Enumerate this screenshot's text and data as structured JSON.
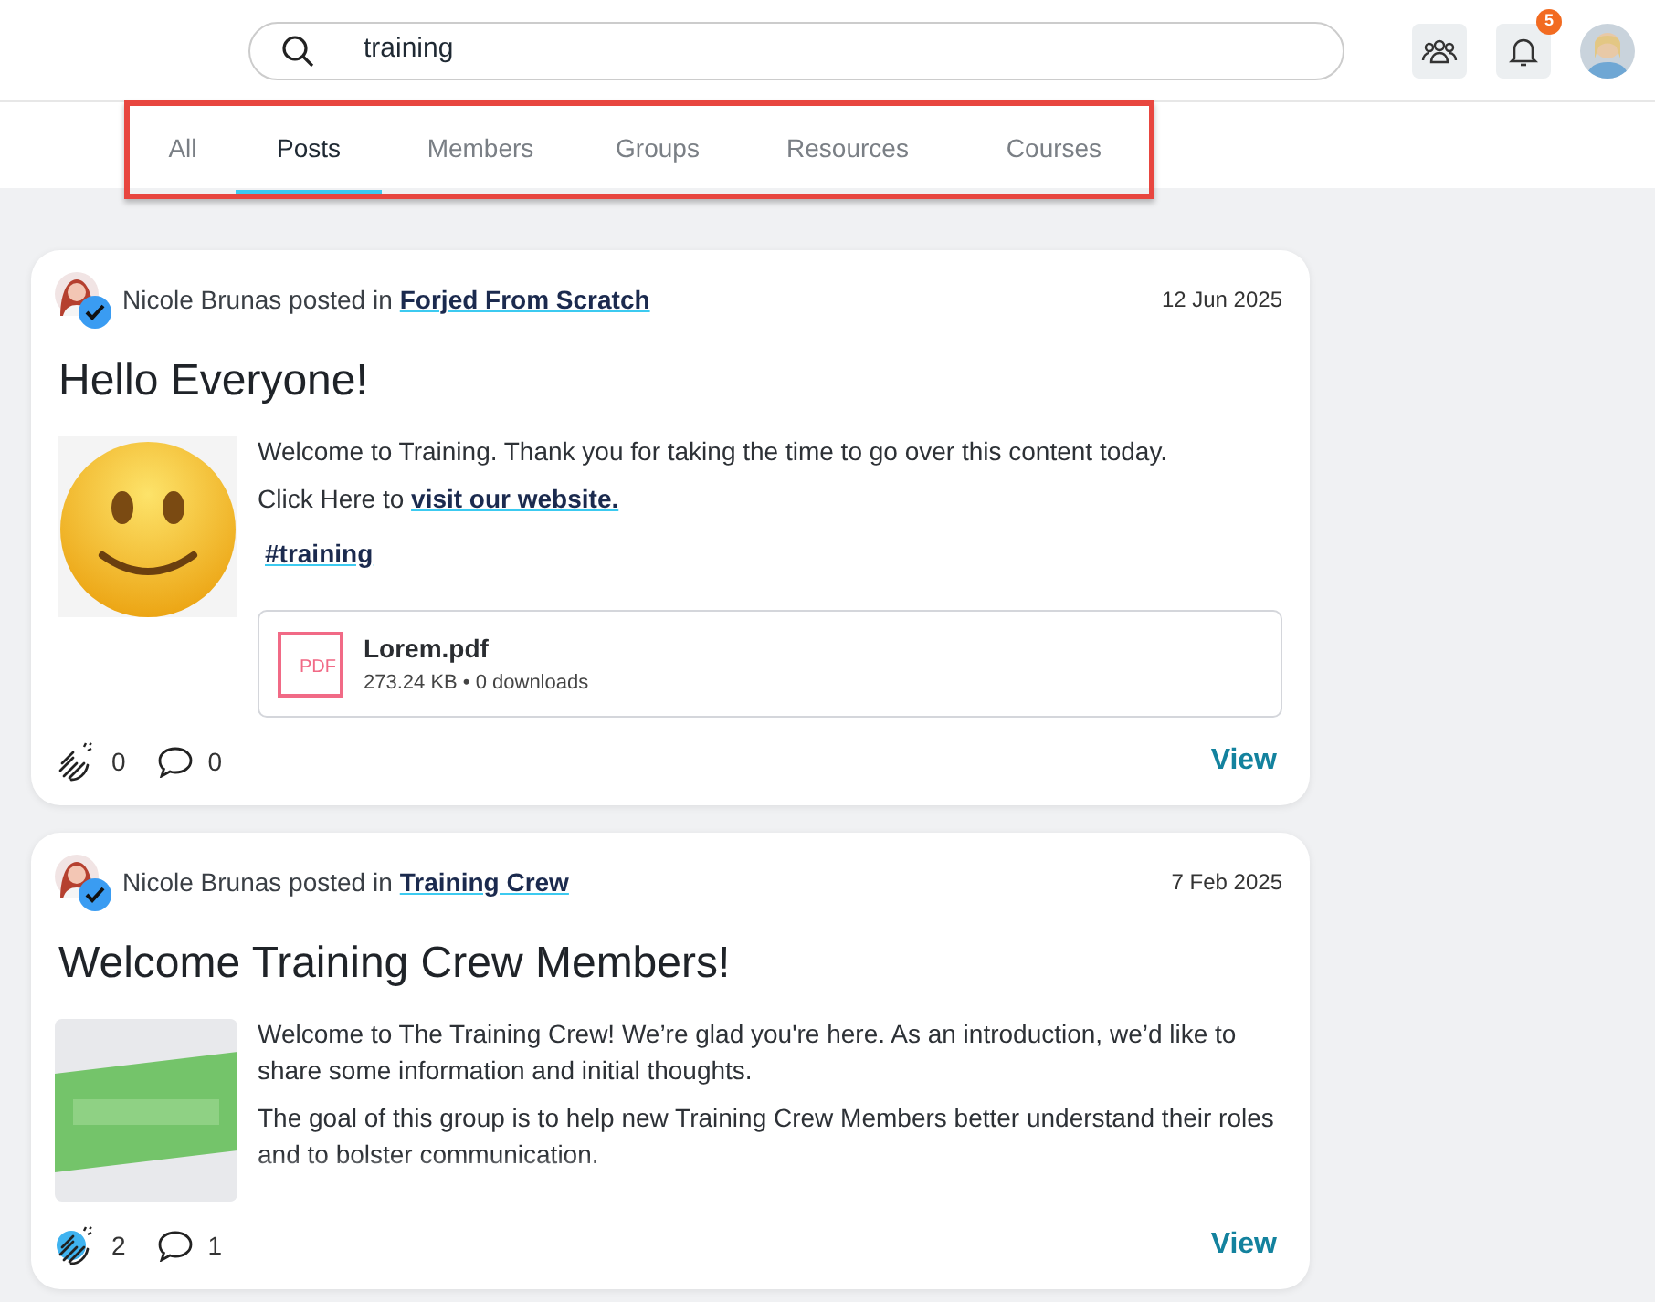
{
  "search": {
    "value": "training"
  },
  "notifications": {
    "count": "5"
  },
  "tabs": [
    {
      "label": "All",
      "selected": false
    },
    {
      "label": "Posts",
      "selected": true
    },
    {
      "label": "Members",
      "selected": false
    },
    {
      "label": "Groups",
      "selected": false
    },
    {
      "label": "Resources",
      "selected": false
    },
    {
      "label": "Courses",
      "selected": false
    }
  ],
  "posts": [
    {
      "author": "Nicole Brunas",
      "action": "posted in",
      "group": "Forjed From Scratch",
      "date": "12 Jun 2025",
      "title": "Hello Everyone!",
      "image": {
        "kind": "emoji"
      },
      "paragraphs": [
        "Welcome to Training. Thank you for taking the time to go over this content today.",
        "Click Here to "
      ],
      "link": "visit our website.",
      "hashtag": "#training",
      "attachment": {
        "name": "Lorem.pdf",
        "type": "PDF",
        "meta": "273.24 KB • 0 downloads"
      },
      "reacted": false,
      "reactions": "0",
      "comments": "0",
      "action_label": "View"
    },
    {
      "author": "Nicole Brunas",
      "action": "posted in",
      "group": "Training Crew",
      "date": "7 Feb 2025",
      "title": "Welcome Training Crew Members!",
      "paragraphs": [
        "Welcome to The Training Crew! We’re glad you're here. As an introduction, we’d like to share some information and initial thoughts.",
        "The goal of this group is to help new Training Crew Members better understand their roles and to bolster communication."
      ],
      "reacted": true,
      "reactions": "2",
      "comments": "1",
      "action_label": "View"
    }
  ]
}
